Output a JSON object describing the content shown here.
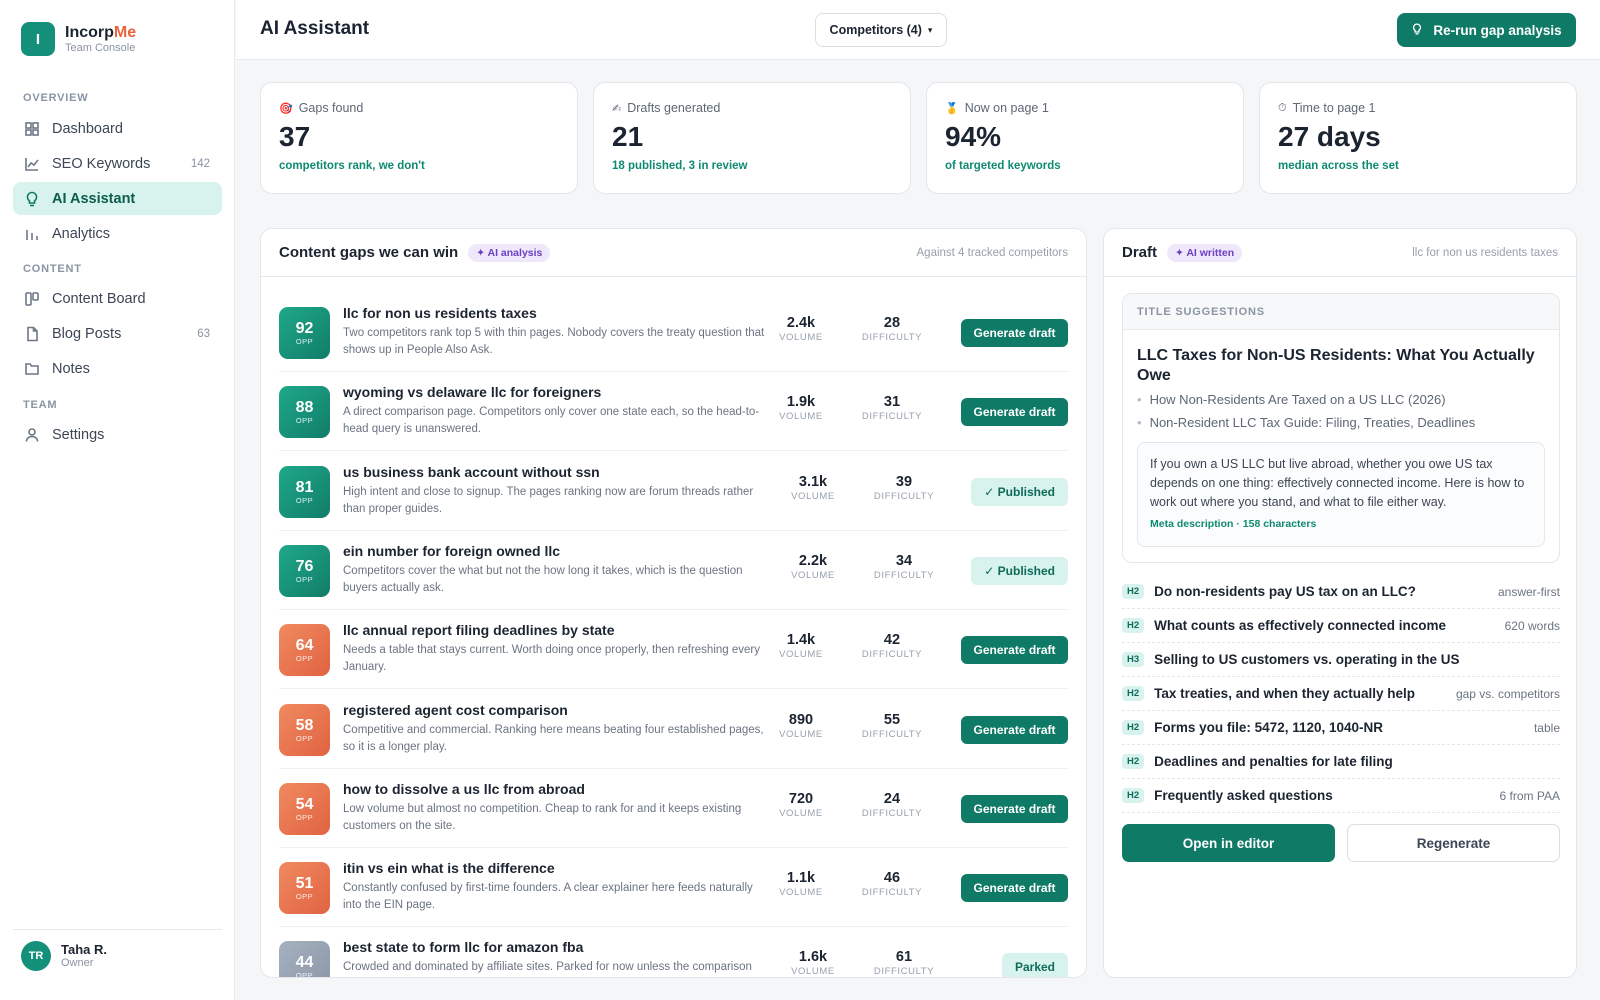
{
  "brand": {
    "logo_letter": "I",
    "name_a": "Incorp",
    "name_b": "Me",
    "subtitle": "Team Console",
    "accent": "#e8643c",
    "brand_color": "#14907a"
  },
  "sidebar": {
    "sections": {
      "overview": "OVERVIEW",
      "content": "CONTENT",
      "team": "TEAM"
    },
    "items": [
      {
        "label": "Dashboard",
        "icon": "grid-icon",
        "count": ""
      },
      {
        "label": "SEO Keywords",
        "icon": "chart-line-icon",
        "count": "142"
      },
      {
        "label": "AI Assistant",
        "icon": "lightbulb-icon",
        "count": "",
        "active": true
      },
      {
        "label": "Analytics",
        "icon": "bar-chart-icon",
        "count": ""
      },
      {
        "label": "Content Board",
        "icon": "kanban-icon",
        "count": ""
      },
      {
        "label": "Blog Posts",
        "icon": "document-icon",
        "count": "63"
      },
      {
        "label": "Notes",
        "icon": "folder-icon",
        "count": ""
      },
      {
        "label": "Settings",
        "icon": "user-icon",
        "count": ""
      }
    ],
    "user": {
      "initials": "TR",
      "name": "Taha R.",
      "role": "Owner"
    }
  },
  "header": {
    "title": "AI Assistant",
    "competitors_label": "Competitors (4)",
    "rerun_label": "Re-run gap analysis"
  },
  "stats": [
    {
      "icon": "target-icon",
      "label": "Gaps found",
      "value": "37",
      "sub": "competitors rank, we don't"
    },
    {
      "icon": "pencil-icon",
      "label": "Drafts generated",
      "value": "21",
      "sub": "18 published, 3 in review"
    },
    {
      "icon": "medal-icon",
      "label": "Now on page 1",
      "value": "94%",
      "sub": "of targeted keywords"
    },
    {
      "icon": "timer-icon",
      "label": "Time to page 1",
      "value": "27 days",
      "sub": "median across the set"
    }
  ],
  "gaps": {
    "title": "Content gaps we can win",
    "badge": "✦ AI analysis",
    "meta": "Against 4 tracked competitors",
    "opp_label": "OPP",
    "volume_label": "VOLUME",
    "difficulty_label": "DIFFICULTY",
    "rows": [
      {
        "score": "92",
        "tone": "teal",
        "title": "llc for non us residents taxes",
        "desc": "Two competitors rank top 5 with thin pages. Nobody covers the treaty question that shows up in People Also Ask.",
        "volume": "2.4k",
        "difficulty": "28",
        "action": "Generate draft",
        "status": ""
      },
      {
        "score": "88",
        "tone": "teal",
        "title": "wyoming vs delaware llc for foreigners",
        "desc": "A direct comparison page. Competitors only cover one state each, so the head-to-head query is unanswered.",
        "volume": "1.9k",
        "difficulty": "31",
        "action": "Generate draft",
        "status": ""
      },
      {
        "score": "81",
        "tone": "teal",
        "title": "us business bank account without ssn",
        "desc": "High intent and close to signup. The pages ranking now are forum threads rather than proper guides.",
        "volume": "3.1k",
        "difficulty": "39",
        "action": "",
        "status": "✓ Published"
      },
      {
        "score": "76",
        "tone": "teal",
        "title": "ein number for foreign owned llc",
        "desc": "Competitors cover the what but not the how long it takes, which is the question buyers actually ask.",
        "volume": "2.2k",
        "difficulty": "34",
        "action": "",
        "status": "✓ Published"
      },
      {
        "score": "64",
        "tone": "orange",
        "title": "llc annual report filing deadlines by state",
        "desc": "Needs a table that stays current. Worth doing once properly, then refreshing every January.",
        "volume": "1.4k",
        "difficulty": "42",
        "action": "Generate draft",
        "status": ""
      },
      {
        "score": "58",
        "tone": "orange",
        "title": "registered agent cost comparison",
        "desc": "Competitive and commercial. Ranking here means beating four established pages, so it is a longer play.",
        "volume": "890",
        "difficulty": "55",
        "action": "Generate draft",
        "status": ""
      },
      {
        "score": "54",
        "tone": "orange",
        "title": "how to dissolve a us llc from abroad",
        "desc": "Low volume but almost no competition. Cheap to rank for and it keeps existing customers on the site.",
        "volume": "720",
        "difficulty": "24",
        "action": "Generate draft",
        "status": ""
      },
      {
        "score": "51",
        "tone": "orange",
        "title": "itin vs ein what is the difference",
        "desc": "Constantly confused by first-time founders. A clear explainer here feeds naturally into the EIN page.",
        "volume": "1.1k",
        "difficulty": "46",
        "action": "Generate draft",
        "status": ""
      },
      {
        "score": "44",
        "tone": "grey",
        "title": "best state to form llc for amazon fba",
        "desc": "Crowded and dominated by affiliate sites. Parked for now unless the comparison",
        "volume": "1.6k",
        "difficulty": "61",
        "action": "",
        "status": "Parked"
      }
    ]
  },
  "draft": {
    "title": "Draft",
    "badge": "✦ AI written",
    "keyword": "llc for non us residents taxes",
    "suggestions_head": "TITLE SUGGESTIONS",
    "main_title": "LLC Taxes for Non-US Residents: What You Actually Owe",
    "alt_titles": [
      "How Non-Residents Are Taxed on a US LLC (2026)",
      "Non-Resident LLC Tax Guide: Filing, Treaties, Deadlines"
    ],
    "meta_description": "If you own a US LLC but live abroad, whether you owe US tax depends on one thing: effectively connected income. Here is how to work out where you stand, and what to file either way.",
    "meta_foot": "Meta description · 158 characters",
    "outline": [
      {
        "tag": "H2",
        "text": "Do non-residents pay US tax on an LLC?",
        "note": "answer-first"
      },
      {
        "tag": "H2",
        "text": "What counts as effectively connected income",
        "note": "620 words"
      },
      {
        "tag": "H3",
        "text": "Selling to US customers vs. operating in the US",
        "note": ""
      },
      {
        "tag": "H2",
        "text": "Tax treaties, and when they actually help",
        "note": "gap vs. competitors"
      },
      {
        "tag": "H2",
        "text": "Forms you file: 5472, 1120, 1040-NR",
        "note": "table"
      },
      {
        "tag": "H2",
        "text": "Deadlines and penalties for late filing",
        "note": ""
      },
      {
        "tag": "H2",
        "text": "Frequently asked questions",
        "note": "6 from PAA"
      }
    ],
    "open_label": "Open in editor",
    "regen_label": "Regenerate"
  }
}
